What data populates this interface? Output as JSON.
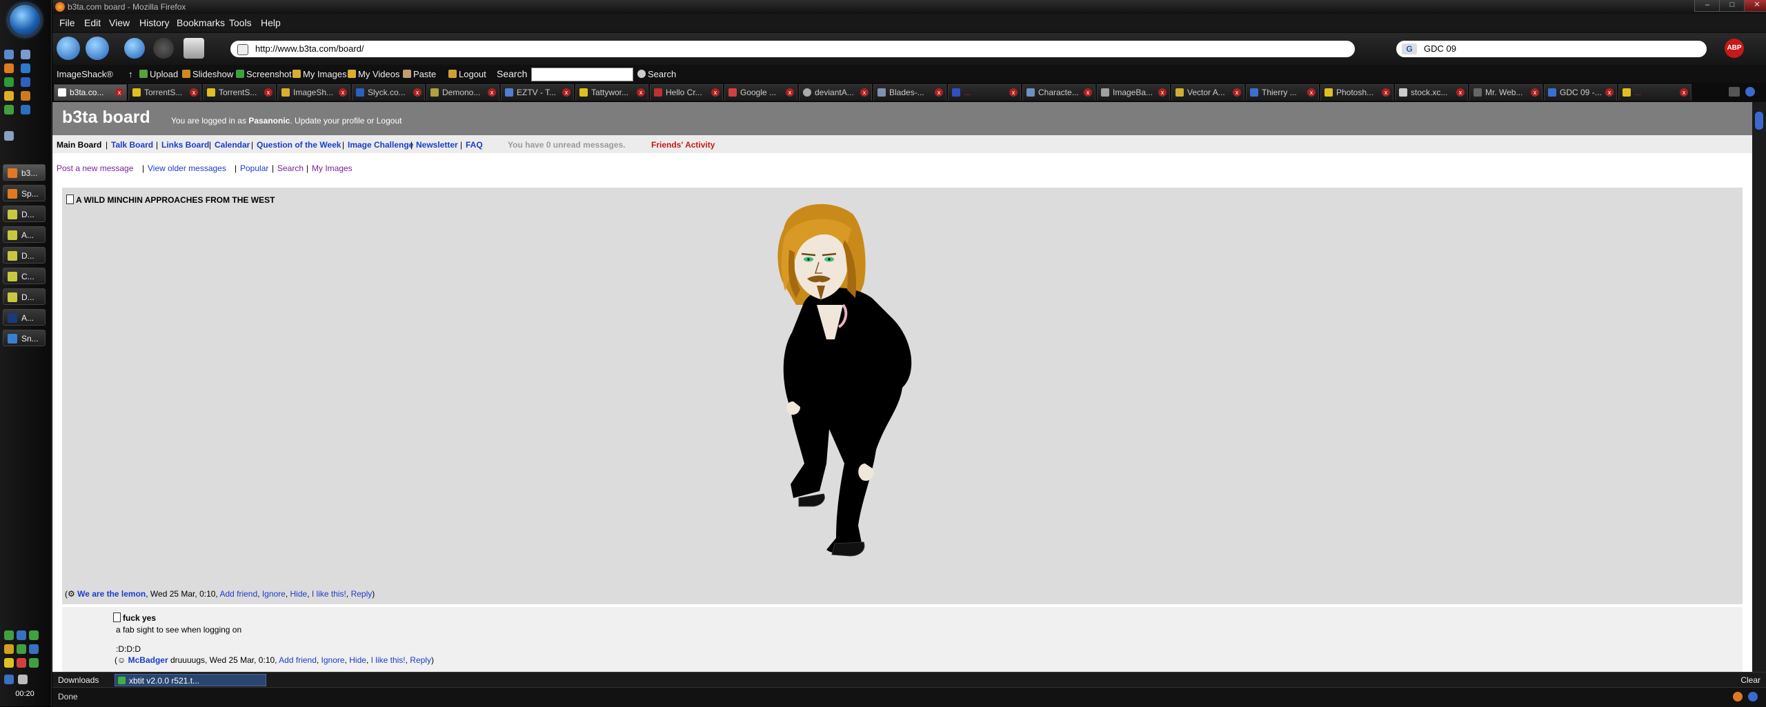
{
  "window": {
    "title": "b3ta.com board - Mozilla Firefox"
  },
  "menu": [
    "File",
    "Edit",
    "View",
    "History",
    "Bookmarks",
    "Tools",
    "Help"
  ],
  "address": {
    "url": "http://www.b3ta.com/board/"
  },
  "search": {
    "value": "GDC 09"
  },
  "adblock_label": "ABP",
  "bookmarks": {
    "imageshack": "ImageShack®",
    "upload": "Upload",
    "slideshow": "Slideshow",
    "screenshot": "Screenshot",
    "my_images": "My Images",
    "my_videos": "My Videos",
    "paste": "Paste",
    "logout": "Logout",
    "search_label": "Search",
    "search_button": "Search"
  },
  "tabs": [
    "b3ta.co...",
    "TorrentS...",
    "TorrentS...",
    "ImageSh...",
    "Slyck.co...",
    "Demono...",
    "EZTV - T...",
    "Tattywor...",
    "Hello Cr...",
    "Google ...",
    "deviantA...",
    "Blades-...",
    "...",
    "Characte...",
    "ImageBa...",
    "Vector A...",
    "Thierry ...",
    "Photosh...",
    "stock.xc...",
    "Mr. Web...",
    "GDC 09 -...",
    "..."
  ],
  "taskbar": {
    "items": [
      "b3...",
      "Sp...",
      "D...",
      "A...",
      "D...",
      "C...",
      "D...",
      "A...",
      "Sn..."
    ],
    "clock": "00:20"
  },
  "board": {
    "title": "b3ta board",
    "login_prefix": "You are logged in as",
    "username": "Pasanonic",
    "login_suffix": ". Update your profile or Logout",
    "nav": {
      "main": "Main Board",
      "talk": "Talk Board",
      "links": "Links Board",
      "calendar": "Calendar",
      "qotw": "Question of the Week",
      "image_challenge": "Image Challenge",
      "newsletter": "Newsletter",
      "faq": "FAQ",
      "unread": "You have 0 unread messages.",
      "friends": "Friends' Activity"
    },
    "subnav": {
      "post_new": "Post a new message",
      "older": "View older messages",
      "popular": "Popular",
      "search": "Search",
      "my_images": "My Images"
    },
    "post": {
      "title": "A WILD MINCHIN APPROACHES FROM THE WEST",
      "author": "We are the lemon",
      "date": ", Wed 25 Mar, 0:10, ",
      "actions": [
        "Add friend",
        "Ignore",
        "Hide",
        "I like this!",
        "Reply"
      ]
    },
    "reply": {
      "title": "fuck yes",
      "body": "a fab sight to see when logging on",
      "smile": ":D:D:D",
      "author": "McBadger",
      "tagline": " druuuugs, Wed 25 Mar, 0:10, ",
      "actions": [
        "Add friend",
        "Ignore",
        "Hide",
        "I like this!",
        "Reply"
      ]
    }
  },
  "downloads": {
    "label": "Downloads",
    "item": "xbtit v2.0.0 r521.t...",
    "clear": "Clear"
  },
  "status": "Done",
  "colors": {
    "header_gray": "#7d7d7d",
    "link_blue": "#1a3cc9",
    "friends_red": "#c81818",
    "purple_link": "#7a1fa0"
  }
}
